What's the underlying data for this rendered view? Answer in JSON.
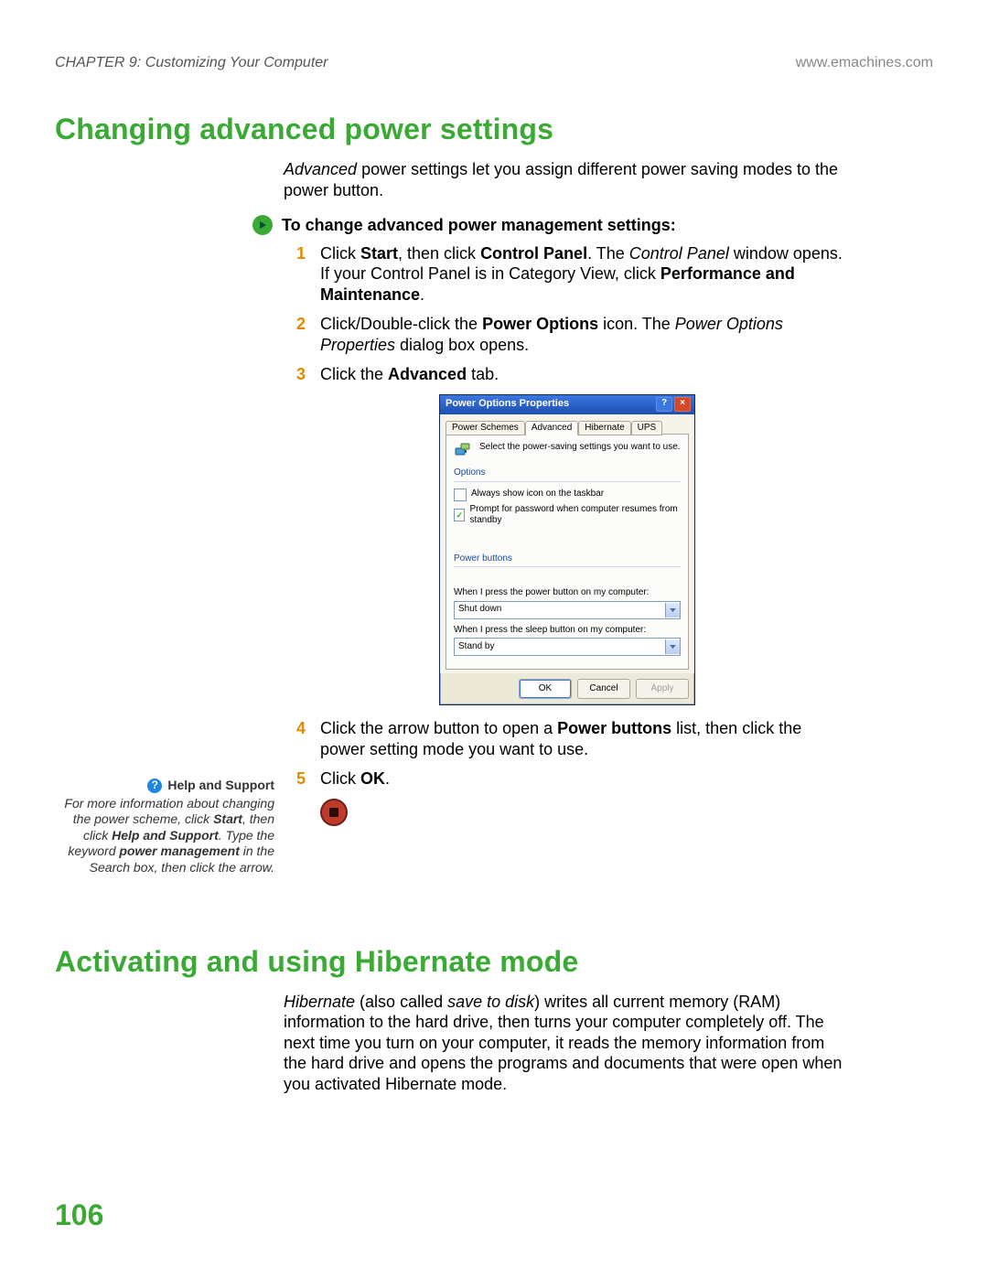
{
  "header": {
    "chapter": "CHAPTER 9: Customizing Your Computer",
    "url": "www.emachines.com"
  },
  "page_number": "106",
  "section1": {
    "title": "Changing advanced power settings",
    "intro_html": "<i>Advanced</i> power settings let you assign different power saving modes to the power button.",
    "proc_title": "To change advanced power management settings:",
    "steps": [
      "Click <b>Start</b>, then click <b>Control Panel</b>. The <i>Control Panel</i> window opens. If your Control Panel is in Category View, click <b>Performance and Maintenance</b>.",
      "Click/Double-click the <b>Power Options</b> icon. The <i>Power Options Properties</i> dialog box opens.",
      "Click the <b>Advanced</b> tab.",
      "Click the arrow button to open a <b>Power buttons</b> list, then click the power setting mode you want to use.",
      "Click <b>OK</b>."
    ]
  },
  "dialog": {
    "title": "Power Options Properties",
    "tabs": [
      "Power Schemes",
      "Advanced",
      "Hibernate",
      "UPS"
    ],
    "desc": "Select the power-saving settings you want to use.",
    "grp_options": "Options",
    "chk1": "Always show icon on the taskbar",
    "chk2": "Prompt for password when computer resumes from standby",
    "grp_power": "Power buttons",
    "q_power": "When I press the power button on my computer:",
    "v_power": "Shut down",
    "q_sleep": "When I press the sleep button on my computer:",
    "v_sleep": "Stand by",
    "ok": "OK",
    "cancel": "Cancel",
    "apply": "Apply"
  },
  "helpbox": {
    "title": "Help and Support",
    "text_html": "For more information about changing the power scheme, click <b>Start</b>, then click <b>Help and Support</b>. Type the keyword <b>power management</b> in the Search box, then click the arrow."
  },
  "section2": {
    "title": "Activating and using Hibernate mode",
    "intro_html": "<i>Hibernate</i> (also called <i>save to disk</i>) writes all current memory (RAM) information to the hard drive, then turns your computer completely off. The next time you turn on your computer, it reads the memory information from the hard drive and opens the programs and documents that were open when you activated Hibernate mode."
  }
}
